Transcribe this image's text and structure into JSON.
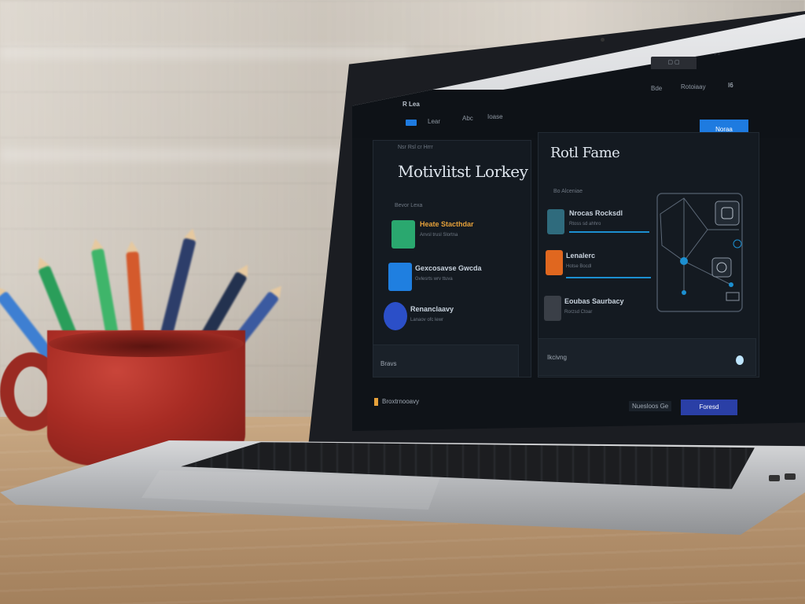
{
  "app": {
    "nav": {
      "logo": "R Lea",
      "items": [
        "Lear",
        "Abc",
        "Ioase"
      ],
      "right_items": [
        "Bde",
        "Rotoiaay",
        "I6"
      ]
    },
    "header_button": "Noraa",
    "left_panel": {
      "breadcrumb": "Nsr Rsl cr Hrrr",
      "title": "Motivlitst Lorkey",
      "section_label": "Bevor Lexa",
      "items": [
        {
          "title": "Heate Stacthdar",
          "subtitle": "Anvsl trusl Slortna",
          "icon_color": "#2aa86f",
          "title_color": "#e6a13a"
        },
        {
          "title": "Gexcosavse Gwcda",
          "subtitle": "Gvlesrts wrv ttuva",
          "icon_color": "#1f7fe0",
          "title_color": "#c9d3de"
        },
        {
          "title": "Renanclaavy",
          "subtitle": "Lanaov ofc lewr",
          "icon_color": "#2b4fc8",
          "title_color": "#c9d3de"
        }
      ],
      "footer": "Bravs"
    },
    "right_panel": {
      "title": "Rotl Fame",
      "section_label": "Bo Alceniae",
      "items": [
        {
          "title": "Nrocas Rocksdl",
          "subtitle": "Rtoss sd ahhro",
          "icon_color": "#2f6b7d",
          "title_color": "#c9d3de"
        },
        {
          "title": "Lenalerc",
          "subtitle": "Hotse Bocdl",
          "icon_color": "#e0671f",
          "title_color": "#c9d3de"
        },
        {
          "title": "Eoubas Saurbacy",
          "subtitle": "Rorzsd Ctoar",
          "icon_color": "#3a3f47",
          "title_color": "#c9d3de"
        }
      ],
      "footer": "Ikcivng"
    },
    "bottom_bar": {
      "left_label": "Broxtrnooavy",
      "right_label": "Nuesloos Ge",
      "button": "Foresd"
    }
  },
  "colors": {
    "accent": "#1e7be0",
    "panel": "#141a21",
    "background": "#0f1318"
  }
}
